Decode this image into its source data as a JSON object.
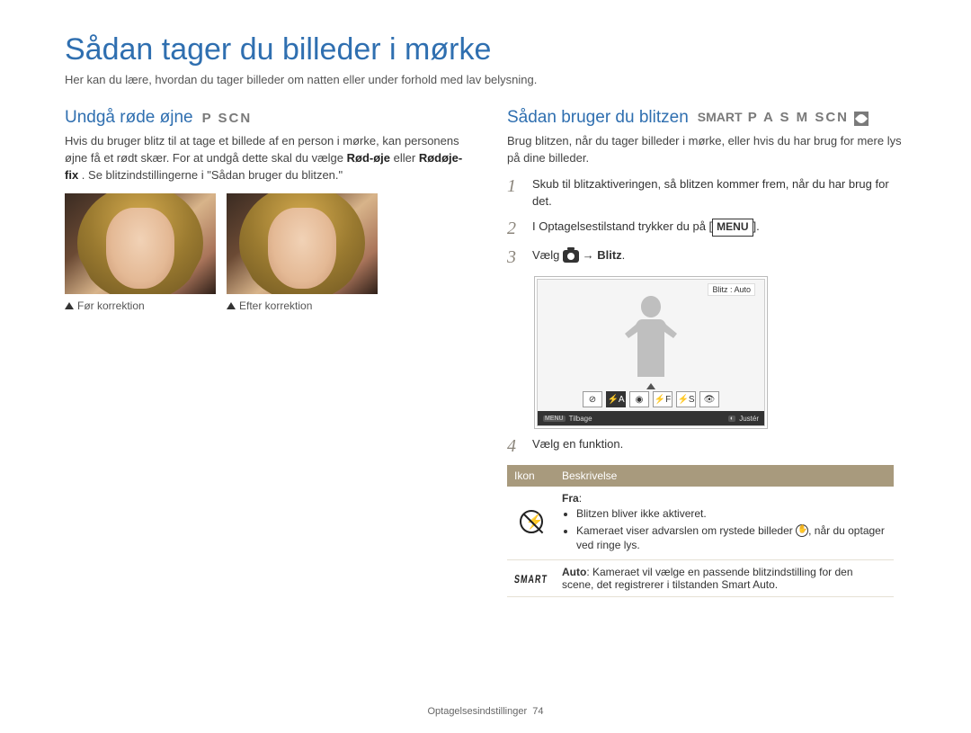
{
  "page": {
    "title": "Sådan tager du billeder i mørke",
    "subtitle": "Her kan du lære, hvordan du tager billeder om natten eller under forhold med lav belysning."
  },
  "left": {
    "heading": "Undgå røde øjne",
    "modes": "P SCN",
    "para1_a": "Hvis du bruger blitz til at tage et billede af en person i mørke, kan personens øjne få et rødt skær. For at undgå dette skal du vælge ",
    "para1_b1": "Rød-øje",
    "para1_mid": " eller ",
    "para1_b2": "Rødøje-fix",
    "para1_c": ". Se blitzindstillingerne i \"Sådan bruger du blitzen.\"",
    "cap_before": "Før korrektion",
    "cap_after": "Efter korrektion"
  },
  "right": {
    "heading": "Sådan bruger du blitzen",
    "modes": "SMART P A S M SCN",
    "intro": "Brug blitzen, når du tager billeder i mørke, eller hvis du har brug for mere lys på dine billeder.",
    "steps": {
      "s1": "Skub til blitzaktiveringen, så blitzen kommer frem, når du har brug for det.",
      "s2_a": "I Optagelsestilstand trykker du på [",
      "s2_menu": "MENU",
      "s2_b": "].",
      "s3_a": "Vælg ",
      "s3_arrow": " → ",
      "s3_b": "Blitz",
      "s3_c": ".",
      "s4": "Vælg en funktion."
    },
    "screen": {
      "label": "Blitz : Auto",
      "back_label": "Tilbage",
      "adjust_label": "Justér",
      "menu_chip": "MENU"
    },
    "table": {
      "h1": "Ikon",
      "h2": "Beskrivelse",
      "r1": {
        "title": "Fra",
        "b1": "Blitzen bliver ikke aktiveret.",
        "b2_a": "Kameraet viser advarslen om rystede billeder ",
        "b2_b": ", når du optager ved ringe lys."
      },
      "r2": {
        "title": "Auto",
        "desc": ": Kameraet vil vælge en passende blitzindstilling for den scene, det registrerer i tilstanden Smart Auto."
      }
    }
  },
  "footer": {
    "section": "Optagelsesindstillinger",
    "page_num": "74"
  }
}
